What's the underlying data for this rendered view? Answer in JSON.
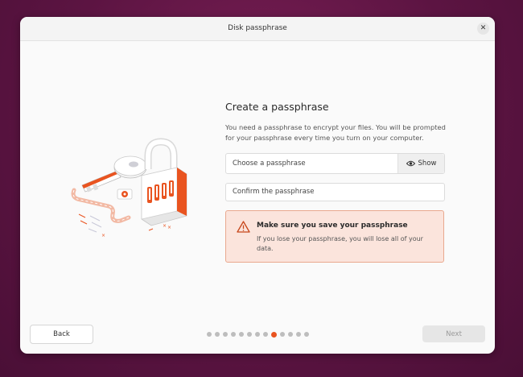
{
  "window": {
    "title": "Disk passphrase",
    "close_icon": "close-icon"
  },
  "main": {
    "heading": "Create a passphrase",
    "description": "You need a passphrase to encrypt your files. You will be prompted for your passphrase every time you turn on your computer.",
    "passphrase_input": {
      "placeholder": "Choose a passphrase",
      "value": ""
    },
    "show_button": {
      "label": "Show",
      "icon": "eye-icon"
    },
    "confirm_input": {
      "placeholder": "Confirm the passphrase",
      "value": ""
    },
    "warning": {
      "icon": "warning-icon",
      "title": "Make sure you save your passphrase",
      "body": "If you lose your passphrase, you will lose all of your data."
    }
  },
  "footer": {
    "back_label": "Back",
    "next_label": "Next",
    "page_indicator": {
      "total": 13,
      "current": 9
    }
  },
  "colors": {
    "accent": "#e95420",
    "warning_bg": "#fbe4dc",
    "warning_border": "#e9a88e",
    "desktop_bg": "#5c1442"
  }
}
